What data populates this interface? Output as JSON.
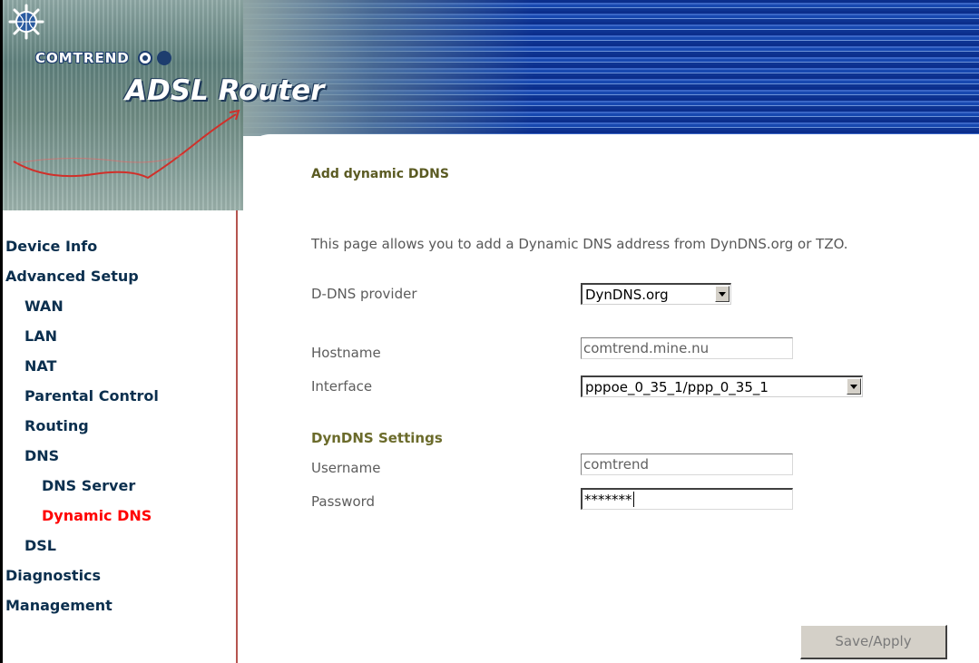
{
  "banner": {
    "brand": "COMTREND",
    "product": "ADSL Router"
  },
  "sidebar": {
    "items": [
      {
        "label": "Device Info",
        "level": 0,
        "active": false
      },
      {
        "label": "Advanced Setup",
        "level": 0,
        "active": false
      },
      {
        "label": "WAN",
        "level": 1,
        "active": false
      },
      {
        "label": "LAN",
        "level": 1,
        "active": false
      },
      {
        "label": "NAT",
        "level": 1,
        "active": false
      },
      {
        "label": "Parental Control",
        "level": 1,
        "active": false
      },
      {
        "label": "Routing",
        "level": 1,
        "active": false
      },
      {
        "label": "DNS",
        "level": 1,
        "active": false
      },
      {
        "label": "DNS Server",
        "level": 2,
        "active": false
      },
      {
        "label": "Dynamic DNS",
        "level": 2,
        "active": true
      },
      {
        "label": "DSL",
        "level": 1,
        "active": false
      },
      {
        "label": "Diagnostics",
        "level": 0,
        "active": false
      },
      {
        "label": "Management",
        "level": 0,
        "active": false
      }
    ]
  },
  "main": {
    "title": "Add dynamic DDNS",
    "description": "This page allows you to add a Dynamic DNS address from DynDNS.org or TZO.",
    "provider_label": "D-DNS provider",
    "provider_value": "DynDNS.org",
    "hostname_label": "Hostname",
    "hostname_value": "comtrend.mine.nu",
    "interface_label": "Interface",
    "interface_value": "pppoe_0_35_1/ppp_0_35_1",
    "settings_heading": "DynDNS Settings",
    "username_label": "Username",
    "username_value": "comtrend",
    "password_label": "Password",
    "password_value": "*******",
    "save_label": "Save/Apply"
  },
  "colors": {
    "nav_text": "#0b2f4e",
    "nav_active": "#ff0000",
    "title": "#5b5b23",
    "divider": "#b5544f"
  }
}
